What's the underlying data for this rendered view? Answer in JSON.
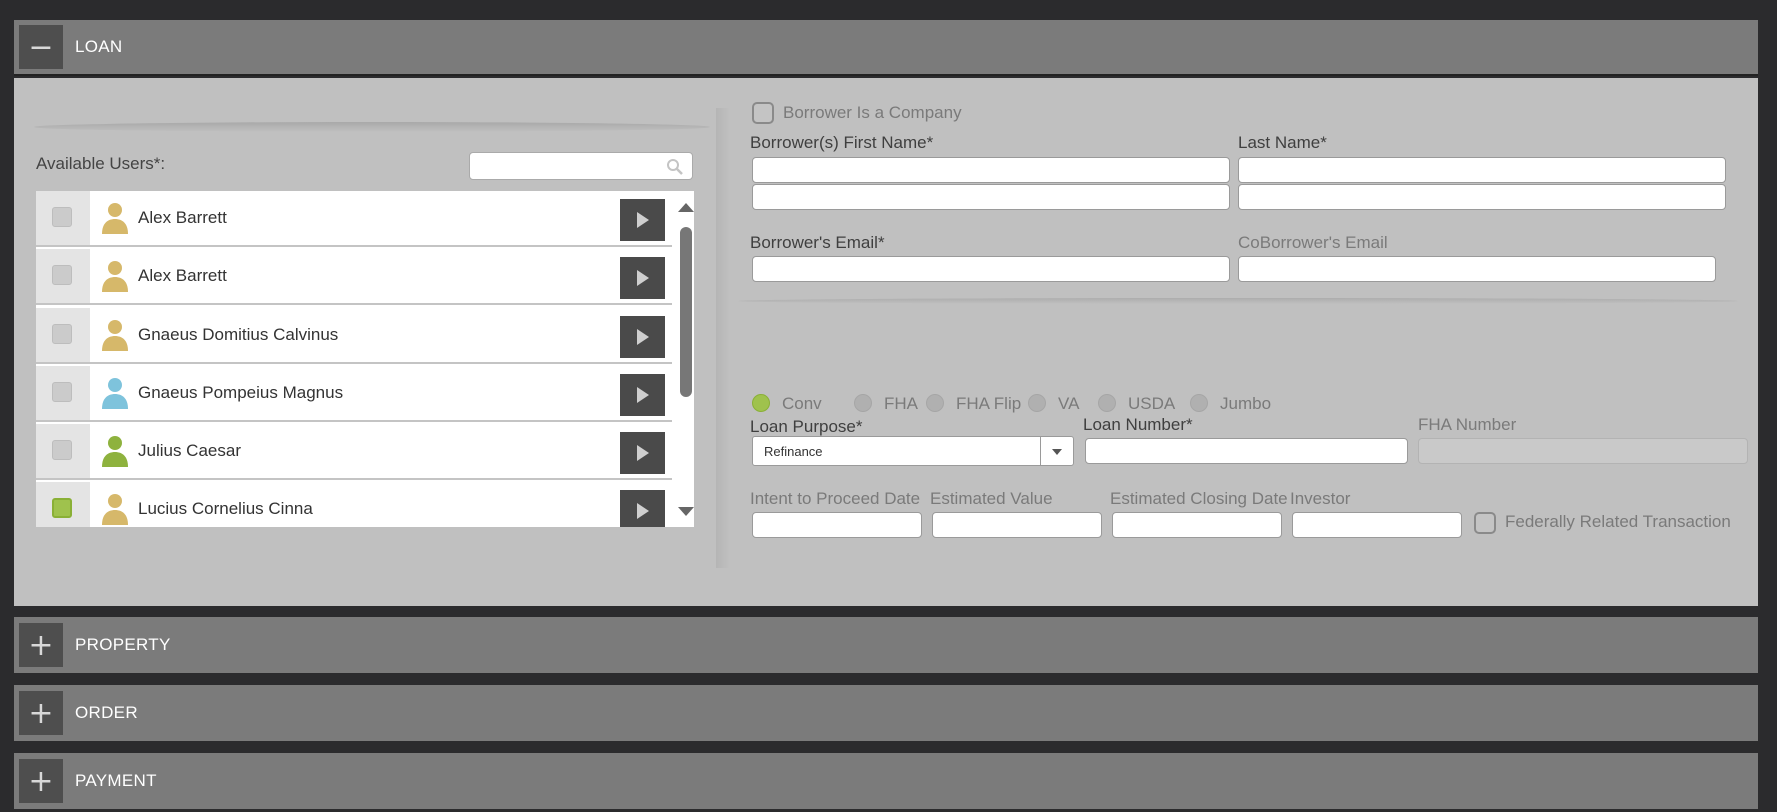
{
  "sections": {
    "loan": {
      "title": "LOAN",
      "toggle": "−"
    },
    "property": {
      "title": "PROPERTY",
      "toggle": "+"
    },
    "order": {
      "title": "ORDER",
      "toggle": "+"
    },
    "payment": {
      "title": "PAYMENT",
      "toggle": "+"
    }
  },
  "users_panel": {
    "label": "Available Users*:",
    "search_placeholder": "",
    "users": [
      {
        "name": "Alex Barrett",
        "checked": false,
        "avatar_color": "#d6b86a"
      },
      {
        "name": "Alex Barrett",
        "checked": false,
        "avatar_color": "#d6b86a"
      },
      {
        "name": "Gnaeus Domitius Calvinus",
        "checked": false,
        "avatar_color": "#d6b86a"
      },
      {
        "name": "Gnaeus Pompeius Magnus",
        "checked": false,
        "avatar_color": "#7ec3dc"
      },
      {
        "name": "Julius Caesar",
        "checked": false,
        "avatar_color": "#8eb23e"
      },
      {
        "name": "Lucius Cornelius Cinna",
        "checked": true,
        "avatar_color": "#d6b86a"
      }
    ]
  },
  "borrower": {
    "company_label": "Borrower Is a Company",
    "first_name_label": "Borrower(s) First Name*",
    "last_name_label": "Last Name*",
    "first_name_1": "",
    "first_name_2": "",
    "last_name_1": "",
    "last_name_2": "",
    "email_label": "Borrower's Email*",
    "coborrower_email_label": "CoBorrower's Email",
    "email": "",
    "coborrower_email": ""
  },
  "loan_type": {
    "options": [
      "Conv",
      "FHA",
      "FHA Flip",
      "VA",
      "USDA",
      "Jumbo"
    ],
    "selected": "Conv"
  },
  "loan_fields": {
    "purpose_label": "Loan Purpose*",
    "purpose_value": "Refinance",
    "number_label": "Loan Number*",
    "fha_number_label": "FHA Number",
    "intent_label": "Intent to Proceed Date",
    "estimated_value_label": "Estimated Value",
    "closing_date_label": "Estimated Closing Date",
    "investor_label": "Investor",
    "federal_label": "Federally Related Transaction"
  },
  "colors": {
    "accent_green": "#9fc24d",
    "header_gray": "#7b7b7b",
    "panel_gray": "#c0c0c0"
  }
}
